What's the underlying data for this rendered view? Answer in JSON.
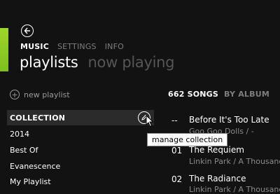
{
  "nav": {
    "items": [
      {
        "label": "MUSIC",
        "active": true
      },
      {
        "label": "SETTINGS",
        "active": false
      },
      {
        "label": "INFO",
        "active": false
      }
    ]
  },
  "pivots": {
    "active": "playlists",
    "inactive": "now playing"
  },
  "sidebar": {
    "new_playlist_label": "new playlist",
    "collection_label": "COLLECTION",
    "playlists": [
      "2014",
      "Best Of",
      "Evanescence",
      "My Playlist"
    ]
  },
  "tooltip": {
    "text": "manage collection"
  },
  "songs": {
    "count_label": "662 SONGS",
    "sort_label": "BY ALBUM",
    "tracks": [
      {
        "number": "--",
        "title": "Before It's Too Late",
        "subtitle": "Goo Goo Dolls  /  -"
      },
      {
        "number": "01",
        "title": "The Requiem",
        "subtitle": "Linkin Park  /  A Thousand"
      },
      {
        "number": "02",
        "title": "The Radiance",
        "subtitle": "Linkin Park  /  A Thousand"
      }
    ]
  },
  "colors": {
    "accent": "#8cc928",
    "background": "#121212",
    "collection_row": "#2b2b2b"
  }
}
